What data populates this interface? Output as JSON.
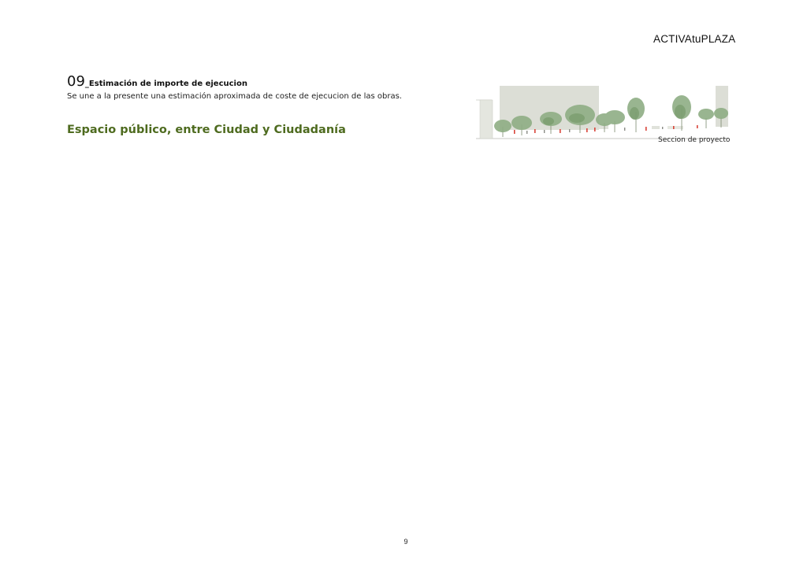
{
  "header": {
    "brand": "ACTIVAtuPLAZA"
  },
  "section": {
    "number": "09",
    "title": "_Estimación de importe de ejecucion",
    "description": "Se une a la presente una estimación aproximada de coste de ejecucion de las obras.",
    "subtitle": "Espacio público, entre Ciudad y Ciudadanía"
  },
  "figure": {
    "caption": "Seccion de proyecto"
  },
  "footer": {
    "page_number": "9"
  },
  "colors": {
    "subtitle_green": "#4e6b1f",
    "building_grey": "#dcded6",
    "tree_green": "#8fae84",
    "accent_red": "#d9443a"
  }
}
